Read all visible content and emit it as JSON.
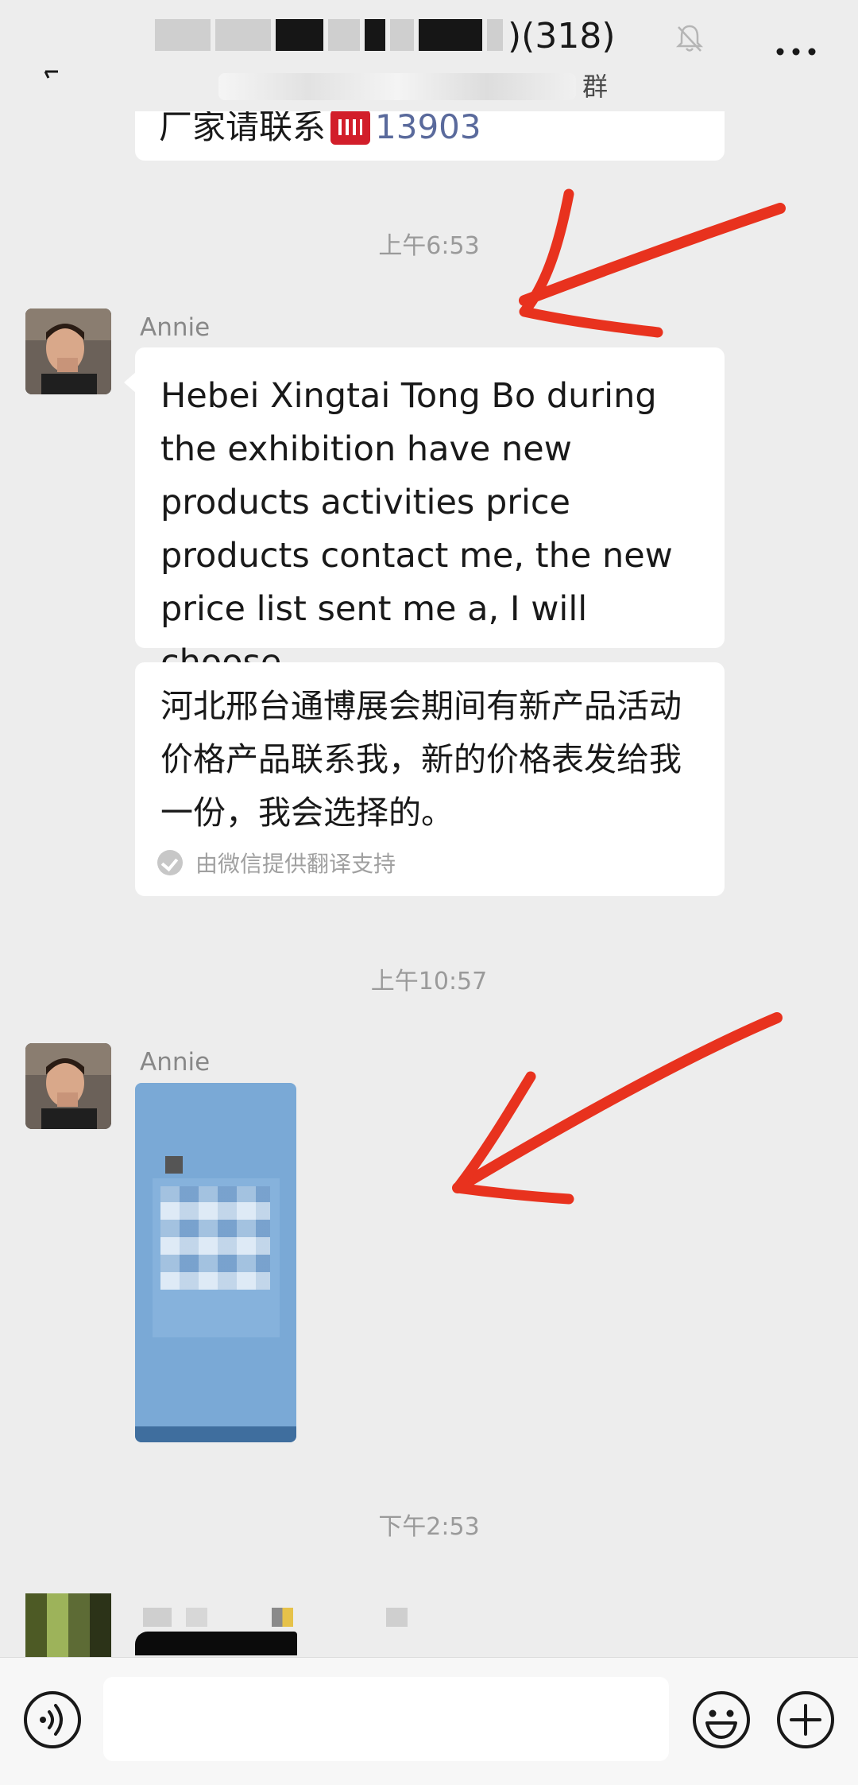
{
  "header": {
    "title_suffix": ")(318)",
    "subtitle_suffix": "群"
  },
  "previous_message": {
    "text_prefix": "厂家请联系",
    "phone": "13903"
  },
  "messages": [
    {
      "time": "上午6:53",
      "sender": "Annie",
      "text": "Hebei Xingtai Tong Bo during the exhibition have new products activities price products contact me, the new price list sent me a, I will choose.",
      "translation": "河北邢台通博展会期间有新产品活动价格产品联系我，新的价格表发给我一份，我会选择的。",
      "translation_note": "由微信提供翻译支持"
    },
    {
      "time": "上午10:57",
      "sender": "Annie"
    },
    {
      "time": "下午2:53"
    }
  ],
  "input": {
    "placeholder": ""
  },
  "colors": {
    "background": "#ededed",
    "bubble": "#ffffff",
    "annotation_arrow": "#e8321e",
    "image_blue": "#7aa9d6"
  },
  "icons": [
    "back-arrow-icon",
    "mute-bell-icon",
    "more-icon",
    "voice-icon",
    "emoji-icon",
    "plus-icon",
    "check-icon"
  ]
}
